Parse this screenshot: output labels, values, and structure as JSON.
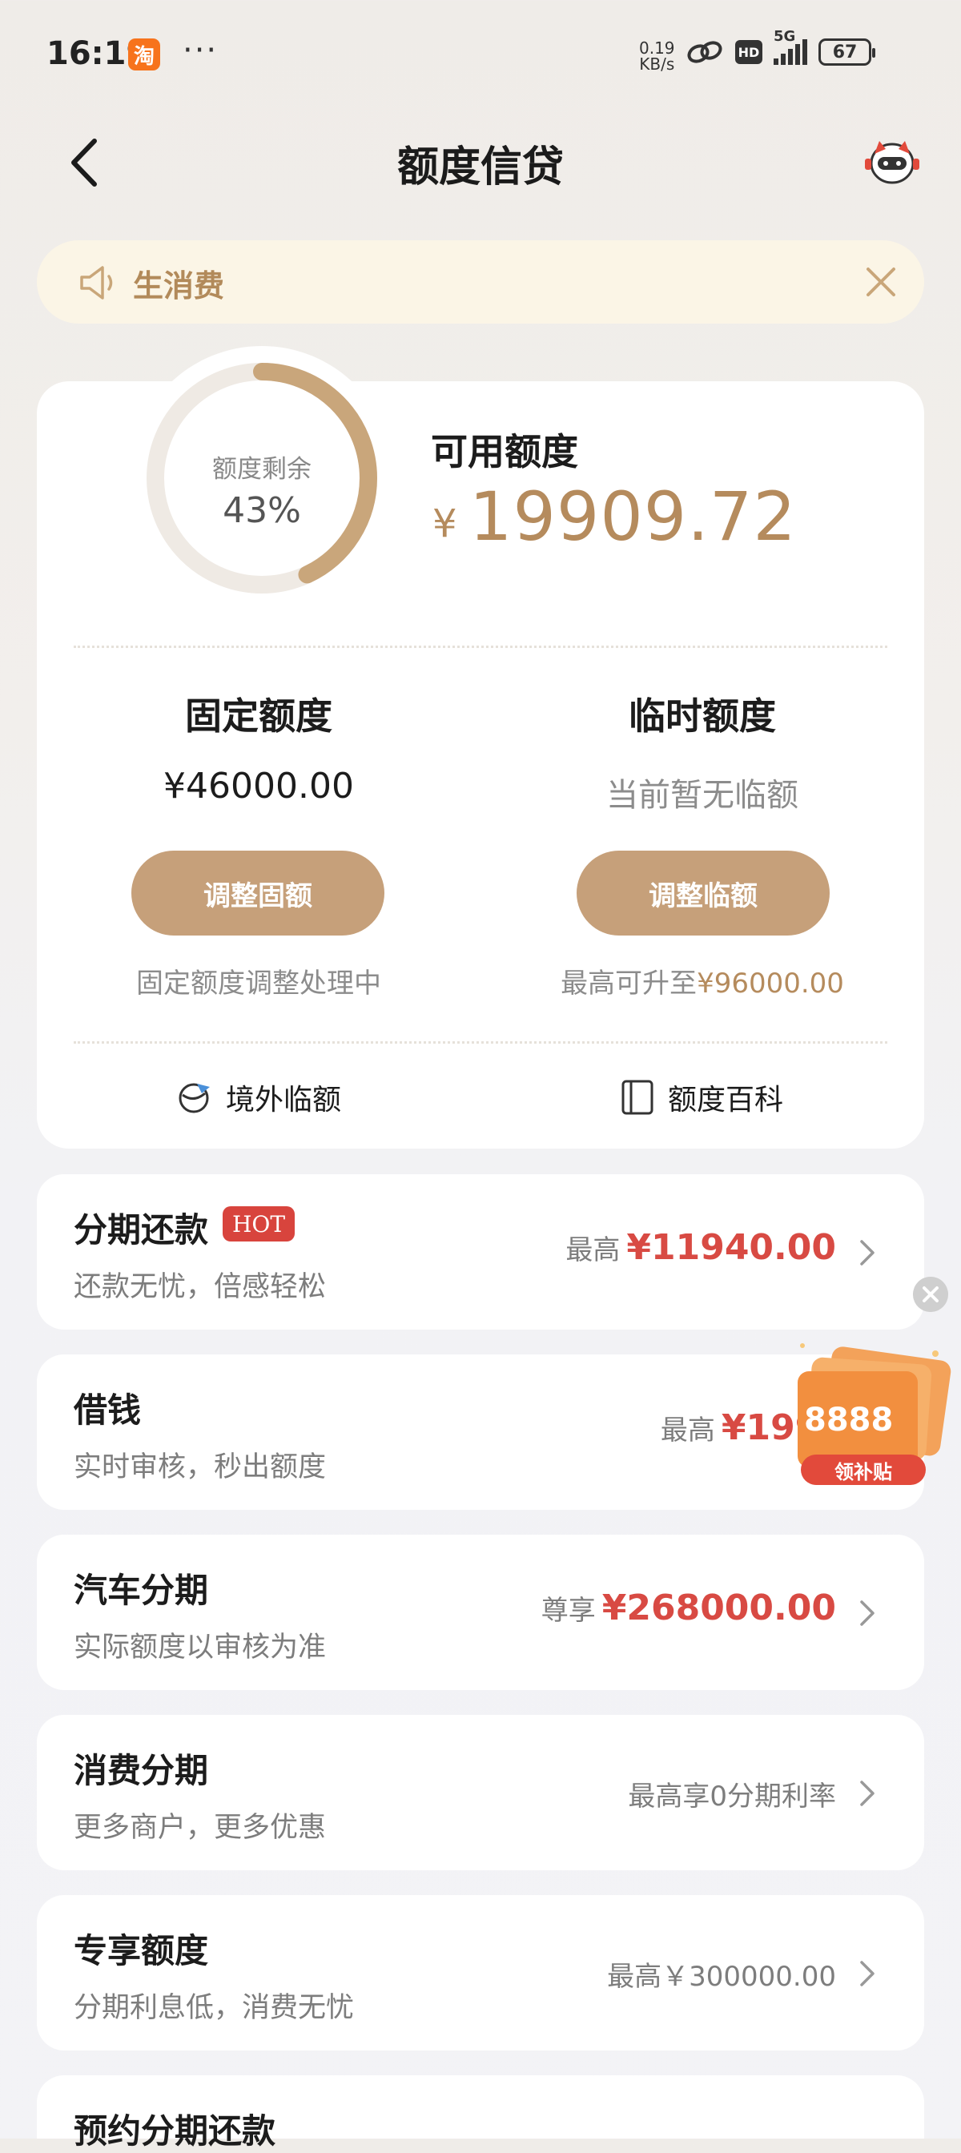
{
  "status_bar": {
    "time": "16:19",
    "app_badge": "淘",
    "more": "···",
    "net_speed_value": "0.19",
    "net_speed_unit": "KB/s",
    "hd": "HD",
    "network": "5G",
    "battery": "67"
  },
  "header": {
    "title": "额度信贷",
    "back_icon": "chevron-left-icon",
    "service_icon": "customer-service-mascot-icon"
  },
  "notice": {
    "text": "生消费",
    "icon": "speaker-icon",
    "close_icon": "close-icon"
  },
  "credit": {
    "ring_label": "额度剩余",
    "ring_percent_text": "43%",
    "remaining_fraction": 0.43,
    "available_label": "可用额度",
    "currency": "¥",
    "available_amount": "19909.72",
    "fixed": {
      "title": "固定额度",
      "value": "¥46000.00",
      "button": "调整固额",
      "note": "固定额度调整处理中"
    },
    "temp": {
      "title": "临时额度",
      "value": "当前暂无临额",
      "button": "调整临额",
      "note_prefix": "最高可升至",
      "note_amount": "¥96000.00"
    },
    "links": [
      {
        "label": "境外临额",
        "icon": "globe-plane-icon"
      },
      {
        "label": "额度百科",
        "icon": "book-icon"
      }
    ]
  },
  "products": [
    {
      "title": "分期还款",
      "tag": "HOT",
      "subtitle": "还款无忧，倍感轻松",
      "prefix": "最高",
      "value": "¥11940.00"
    },
    {
      "title": "借钱",
      "subtitle": "实时审核，秒出额度",
      "prefix": "最高",
      "value": "¥1990"
    },
    {
      "title": "汽车分期",
      "subtitle": "实际额度以审核为准",
      "prefix": "尊享",
      "value": "¥268000.00"
    },
    {
      "title": "消费分期",
      "subtitle": "更多商户，更多优惠",
      "plain": "最高享0分期利率"
    },
    {
      "title": "专享额度",
      "subtitle": "分期利息低，消费无忧",
      "plain": "最高￥300000.00"
    },
    {
      "title": "预约分期还款"
    }
  ],
  "floating_promo": {
    "amount": "8888",
    "button": "领补贴",
    "close_icon": "close-icon"
  },
  "colors": {
    "gold": "#b58b5d",
    "pill": "#c6a07a",
    "red": "#d84a43",
    "notice_bg": "#fbf5e6"
  }
}
